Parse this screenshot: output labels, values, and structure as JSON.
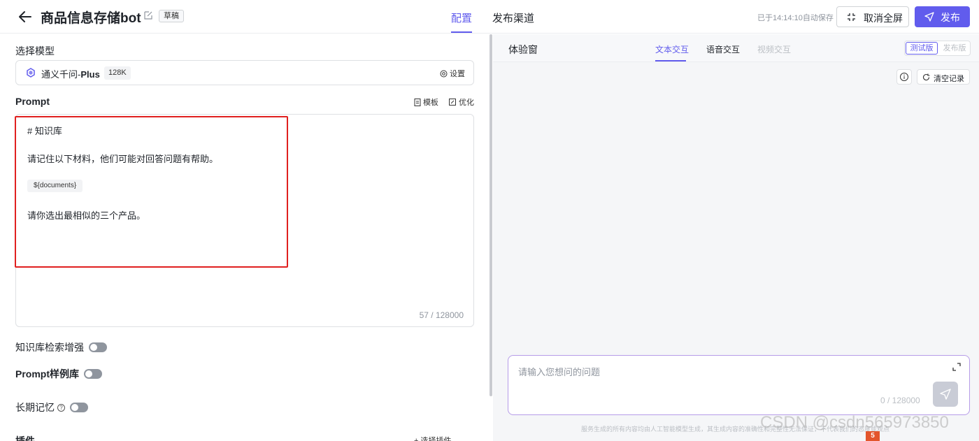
{
  "header": {
    "title": "商品信息存储bot",
    "draft_badge": "草稿",
    "tabs": [
      "配置",
      "发布渠道"
    ],
    "autosave": "已于14:14:10自动保存",
    "fullscreen_label": "取消全屏",
    "publish_label": "发布"
  },
  "config": {
    "model_section_label": "选择模型",
    "model_name_prefix": "通义千问-",
    "model_name_suffix": "Plus",
    "model_context": "128K",
    "model_settings": "设置",
    "prompt_label": "Prompt",
    "template_label": "模板",
    "optimize_label": "优化",
    "prompt_lines": [
      "# 知识库",
      "请记住以下材料，他们可能对回答问题有帮助。",
      "${documents}",
      "请你选出最相似的三个产品。"
    ],
    "char_count": "57 / 128000",
    "toggles": [
      "知识库检索增强",
      "Prompt样例库",
      "长期记忆"
    ],
    "plugin_label": "插件",
    "plugin_action": "+ 选择插件"
  },
  "experience": {
    "title": "体验窗",
    "tabs": [
      "文本交互",
      "语音交互",
      "视频交互"
    ],
    "version_test": "测试版",
    "version_release": "发布版",
    "clear_label": "清空记录",
    "input_placeholder": "请输入您想问的问题",
    "input_count": "0 / 128000",
    "disclaimer": "服务生成的所有内容均由人工智能模型生成，其生成内容的准确性和完整性无法保证，不代表我们的态度或观点"
  },
  "watermark": "CSDN @csdn565973850",
  "colors": {
    "accent": "#615ced",
    "highlight": "#e0201f"
  }
}
